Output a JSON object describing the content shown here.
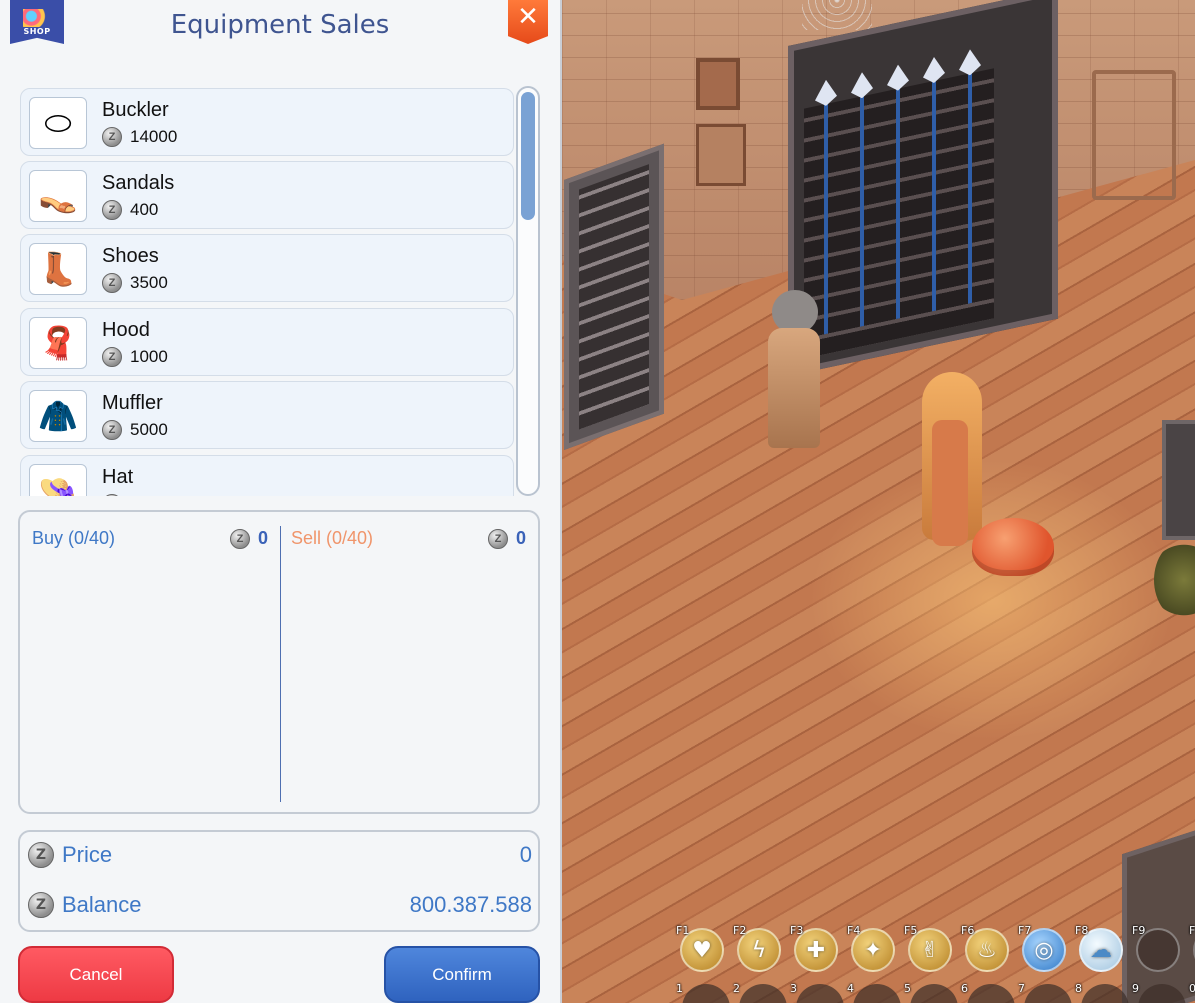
{
  "header": {
    "title": "Equipment Sales",
    "shop_badge": "SHOP",
    "close_icon": "✕"
  },
  "items": [
    {
      "name": "Buckler",
      "price": "14000",
      "icon": "shield-icon"
    },
    {
      "name": "Sandals",
      "price": "400",
      "icon": "sandals-icon"
    },
    {
      "name": "Shoes",
      "price": "3500",
      "icon": "shoes-icon"
    },
    {
      "name": "Hood",
      "price": "1000",
      "icon": "hood-icon"
    },
    {
      "name": "Muffler",
      "price": "5000",
      "icon": "muffler-icon"
    },
    {
      "name": "Hat",
      "price": "",
      "icon": "hat-icon"
    }
  ],
  "cart": {
    "buy_label": "Buy (0/40)",
    "buy_total": "0",
    "sell_label": "Sell (0/40)",
    "sell_total": "0"
  },
  "summary": {
    "price_label": "Price",
    "price_value": "0",
    "balance_label": "Balance",
    "balance_value": "800.387.588"
  },
  "buttons": {
    "cancel": "Cancel",
    "confirm": "Confirm"
  },
  "hotkeys": [
    {
      "key": "F1",
      "icon": "heart-heal-icon"
    },
    {
      "key": "F2",
      "icon": "lightning-icon"
    },
    {
      "key": "F3",
      "icon": "holy-cross-icon"
    },
    {
      "key": "F4",
      "icon": "blessing-icon"
    },
    {
      "key": "F5",
      "icon": "victory-hand-icon"
    },
    {
      "key": "F6",
      "icon": "flame-icon"
    },
    {
      "key": "F7",
      "icon": "shield-aura-icon"
    },
    {
      "key": "F8",
      "icon": "ghost-icon"
    },
    {
      "key": "F9",
      "icon": "empty-slot"
    },
    {
      "key": "F",
      "icon": "empty-slot"
    }
  ],
  "number_row": [
    "1",
    "2",
    "3",
    "4",
    "5",
    "6",
    "7",
    "8",
    "9",
    "0"
  ],
  "colors": {
    "accent_blue": "#3f78c6",
    "title_blue": "#3f5590",
    "sell_orange": "#f0956b",
    "cancel_red": "#ee3a44",
    "confirm_blue": "#2f63bf",
    "close_orange": "#e64a1a"
  }
}
